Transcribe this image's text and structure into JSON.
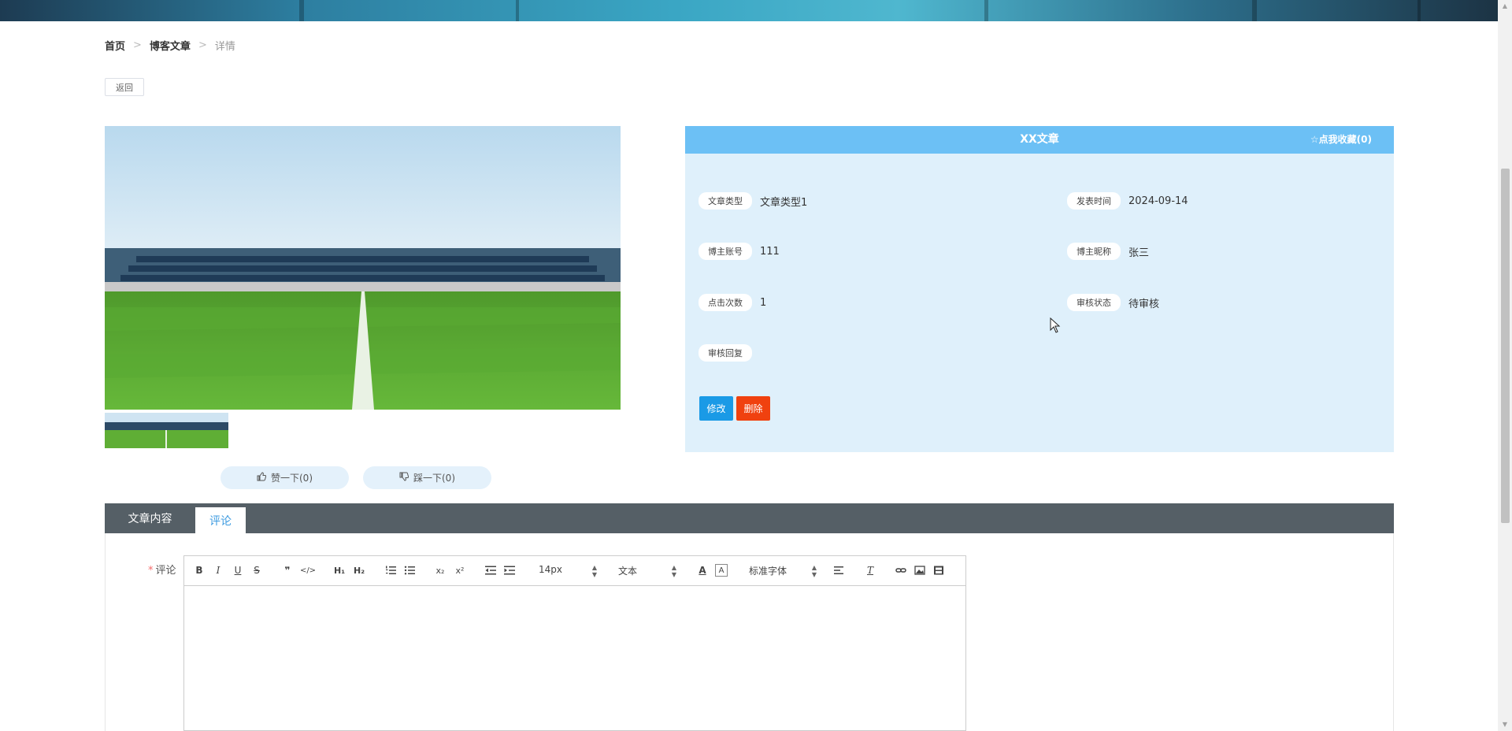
{
  "breadcrumb": {
    "home": "首页",
    "section": "博客文章",
    "current": "详情",
    "separator": ">"
  },
  "back_label": "返回",
  "vote": {
    "like": "赞一下(0)",
    "dislike": "踩一下(0)"
  },
  "article": {
    "title": "XX文章",
    "collect": "点我收藏(0)",
    "fields": {
      "type_label": "文章类型",
      "type_value": "文章类型1",
      "time_label": "发表时间",
      "time_value": "2024-09-14",
      "account_label": "博主账号",
      "account_value": "111",
      "nickname_label": "博主昵称",
      "nickname_value": "张三",
      "clicks_label": "点击次数",
      "clicks_value": "1",
      "status_label": "审核状态",
      "status_value": "待审核",
      "reply_label": "审核回复",
      "reply_value": ""
    },
    "edit_label": "修改",
    "delete_label": "删除"
  },
  "tabs": {
    "content": "文章内容",
    "comment": "评论"
  },
  "comment_form": {
    "required_mark": "*",
    "label": "评论",
    "toolbar": {
      "font_size": "14px",
      "block_type": "文本",
      "font_family": "标准字体"
    }
  },
  "colors": {
    "header": "#6cc0f5",
    "panel": "#dff0fb",
    "edit": "#1a9ae6",
    "delete": "#f0410f",
    "tabbar": "#555f66"
  }
}
